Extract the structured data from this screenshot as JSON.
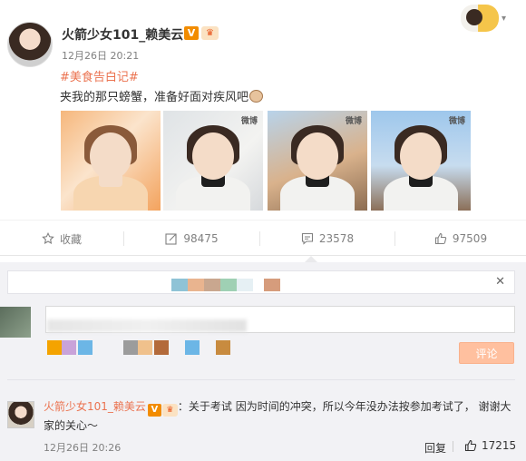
{
  "post": {
    "author": "火箭少女101_赖美云",
    "vip_badge": "V",
    "crown_badge": "♛",
    "time": "12月26日 20:21",
    "hashtag": "#美食告白记#",
    "text": "夹我的那只螃蟹，准备好面对疾风吧",
    "photo_watermark": "微博"
  },
  "actions": {
    "favorite_label": "收藏",
    "repost_count": "98475",
    "comment_count": "23578",
    "like_count": "97509"
  },
  "comment_box": {
    "notice_close": "✕",
    "input_value": "",
    "submit_label": "评论"
  },
  "comment": {
    "author": "火箭少女101_赖美云",
    "vip_badge": "V",
    "crown_badge": "♛",
    "text": "：关于考试 因为时间的冲突，所以今年没办法按参加考试了， 谢谢大家的关心～",
    "time": "12月26日 20:26",
    "reply_label": "回复",
    "like_count": "17215"
  },
  "colors": {
    "accent": "#eb7350",
    "vip": "#f28c00",
    "submit_bg": "#ffc09f",
    "comment_area_bg": "#f2f2f5"
  }
}
